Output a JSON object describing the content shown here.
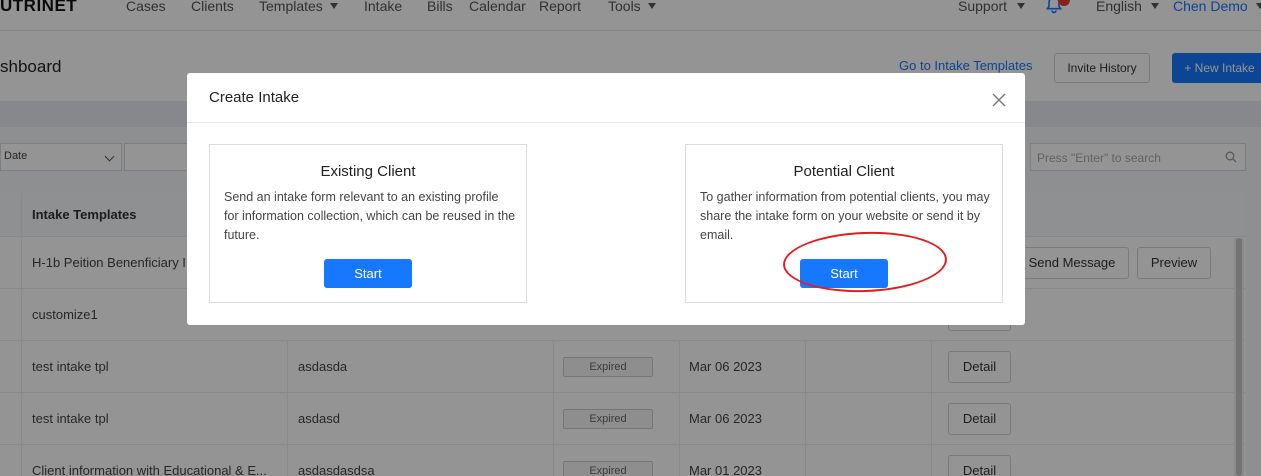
{
  "nav": {
    "logo": "UTRINET",
    "items": [
      {
        "label": "Cases"
      },
      {
        "label": "Clients"
      },
      {
        "label": "Templates"
      },
      {
        "label": "Intake"
      },
      {
        "label": "Bills"
      },
      {
        "label": "Calendar"
      },
      {
        "label": "Report"
      },
      {
        "label": "Tools"
      }
    ],
    "support": "Support",
    "language": "English",
    "user": "Chen Demo"
  },
  "header": {
    "title": "shboard",
    "link": "Go to Intake Templates",
    "invite_history": "Invite History",
    "new_intake": "+ New Intake"
  },
  "filters": {
    "date": "Date",
    "search_placeholder": "Press \"Enter\" to search"
  },
  "table": {
    "col_templates": "Intake Templates",
    "rows": [
      {
        "template": "H-1b Peition Benenficiary I",
        "client": "",
        "status": "",
        "date": "",
        "actions": [
          "Send Message",
          "Preview"
        ]
      },
      {
        "template": "customize1",
        "client": "",
        "status": "",
        "date": "",
        "actions": []
      },
      {
        "template": "test intake tpl",
        "client": "asdasda",
        "status": "Expired",
        "date": "Mar 06 2023",
        "actions": [
          "Detail"
        ]
      },
      {
        "template": "test intake tpl",
        "client": "asdasd",
        "status": "Expired",
        "date": "Mar 06 2023",
        "actions": [
          "Detail"
        ]
      },
      {
        "template": "Client information with Educational & E...",
        "client": "asdasdasdsa",
        "status": "Expired",
        "date": "Mar 01 2023",
        "actions": [
          "Detail"
        ]
      }
    ]
  },
  "modal": {
    "title": "Create Intake",
    "existing": {
      "title": "Existing Client",
      "description": "Send an intake form relevant to an existing profile for information collection, which can be reused in the future.",
      "button": "Start"
    },
    "potential": {
      "title": "Potential Client",
      "description": "To gather information from potential clients, you may share the intake form on your website or send it by email.",
      "button": "Start"
    }
  },
  "colors": {
    "accent": "#1677ff",
    "annotation": "#e02020"
  }
}
